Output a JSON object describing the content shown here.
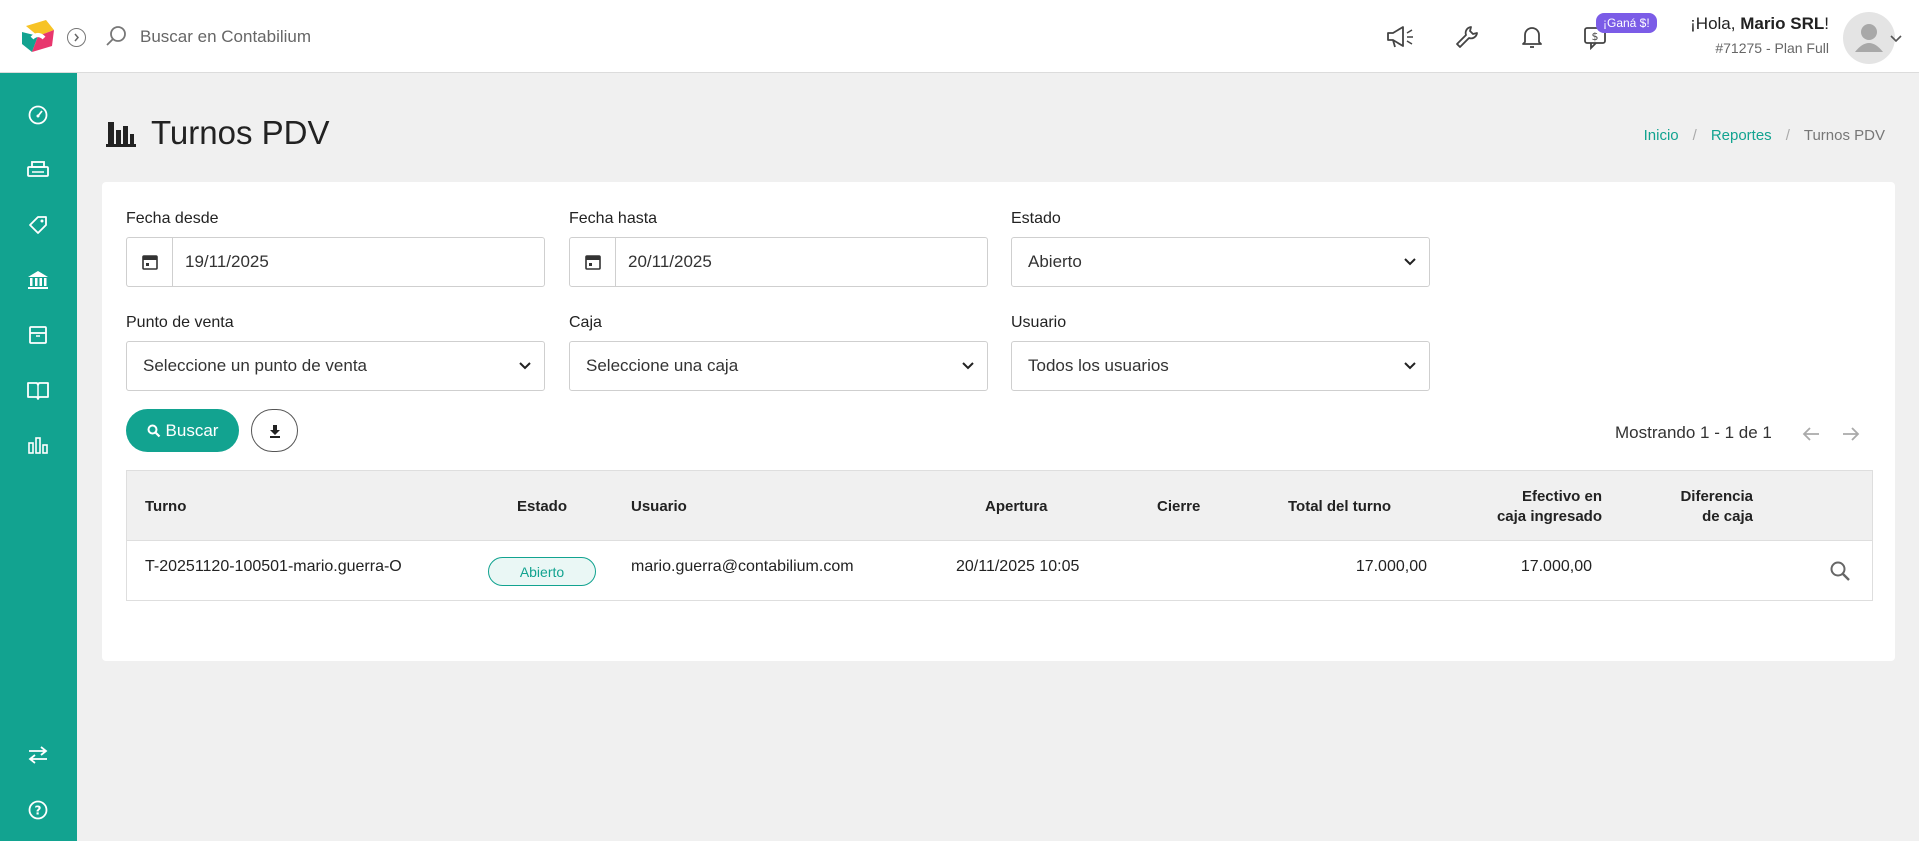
{
  "search": {
    "placeholder": "Buscar en Contabilium"
  },
  "header": {
    "badge": "¡Ganá $!",
    "greeting_prefix": "¡Hola, ",
    "user_name": "Mario SRL",
    "greeting_suffix": "!",
    "plan": "#71275 - Plan Full"
  },
  "page": {
    "title": "Turnos PDV"
  },
  "breadcrumb": {
    "home": "Inicio",
    "reports": "Reportes",
    "current": "Turnos PDV",
    "separator": "/"
  },
  "filters": {
    "fecha_desde_label": "Fecha desde",
    "fecha_desde_value": "19/11/2025",
    "fecha_hasta_label": "Fecha hasta",
    "fecha_hasta_value": "20/11/2025",
    "estado_label": "Estado",
    "estado_value": "Abierto",
    "punto_label": "Punto de venta",
    "punto_value": "Seleccione un punto de venta",
    "caja_label": "Caja",
    "caja_value": "Seleccione una caja",
    "usuario_label": "Usuario",
    "usuario_value": "Todos los usuarios"
  },
  "actions": {
    "search_label": "Buscar"
  },
  "pagination": {
    "text": "Mostrando 1 - 1 de 1"
  },
  "table": {
    "headers": {
      "turno": "Turno",
      "estado": "Estado",
      "usuario": "Usuario",
      "apertura": "Apertura",
      "cierre": "Cierre",
      "total": "Total del turno",
      "efectivo_1": "Efectivo en",
      "efectivo_2": "caja ingresado",
      "diferencia_1": "Diferencia",
      "diferencia_2": "de caja"
    },
    "rows": [
      {
        "turno": "T-20251120-100501-mario.guerra-O",
        "estado": "Abierto",
        "usuario": "mario.guerra@contabilium.com",
        "apertura": "20/11/2025 10:05",
        "cierre": "",
        "total": "17.000,00",
        "efectivo": "17.000,00",
        "diferencia": ""
      }
    ]
  },
  "colors": {
    "accent": "#12a390",
    "badge": "#7b5ce7",
    "background": "#f0f0f0"
  },
  "icons": {
    "sidebar": [
      "dashboard-icon",
      "printer-icon",
      "tag-icon",
      "bank-icon",
      "box-icon",
      "book-icon",
      "bar-chart-icon",
      "transfer-icon",
      "help-icon"
    ],
    "topbar": [
      "megaphone-icon",
      "wrench-icon",
      "bell-icon",
      "money-chat-icon"
    ]
  }
}
